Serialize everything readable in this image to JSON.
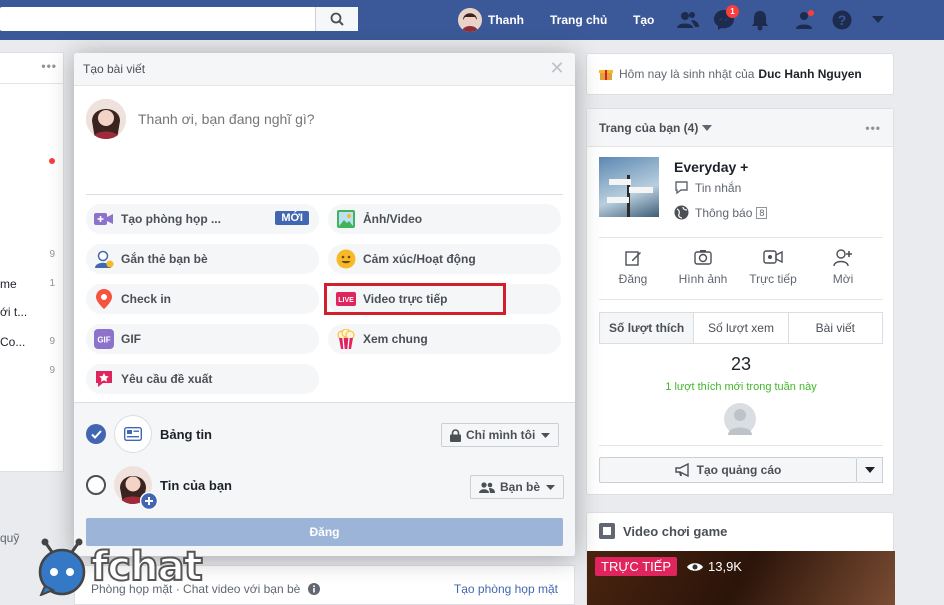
{
  "topbar": {
    "user_name": "Thanh",
    "home": "Trang chủ",
    "create": "Tạo",
    "messenger_badge": "1",
    "icons": [
      "search-icon",
      "friends-icon",
      "messenger-icon",
      "bell-icon",
      "groups-icon",
      "help-icon",
      "caret-down-icon"
    ]
  },
  "left": {
    "rows": [
      {
        "text": "",
        "num": "9"
      },
      {
        "text": "me",
        "num": "1"
      },
      {
        "text": "ới t...",
        "num": ""
      },
      {
        "text": "Co...",
        "num": "9"
      },
      {
        "text": "",
        "num": "9"
      }
    ],
    "bottom": "quỹ"
  },
  "modal": {
    "title": "Tạo bài viết",
    "placeholder": "Thanh ơi, bạn đang nghĩ gì?",
    "actions": [
      {
        "label": "Tạo phòng họp ...",
        "icon": "video-room-icon",
        "badge": "MỚI"
      },
      {
        "label": "Ảnh/Video",
        "icon": "photo-icon"
      },
      {
        "label": "Gắn thẻ bạn bè",
        "icon": "tag-friends-icon"
      },
      {
        "label": "Cảm xúc/Hoạt động",
        "icon": "smiley-icon"
      },
      {
        "label": "Check in",
        "icon": "location-pin-icon"
      },
      {
        "label": "Video trực tiếp",
        "icon": "live-video-icon",
        "icon_text": "LIVE"
      },
      {
        "label": "GIF",
        "icon": "gif-icon",
        "icon_text": "GIF"
      },
      {
        "label": "Xem chung",
        "icon": "popcorn-icon"
      },
      {
        "label": "Yêu cầu đề xuất",
        "icon": "recommendation-icon"
      }
    ],
    "feed_label": "Bảng tin",
    "feed_privacy": "Chỉ mình tôi",
    "story_label": "Tin của bạn",
    "story_privacy": "Bạn bè",
    "post_button": "Đăng"
  },
  "right": {
    "birthday_prefix": "Hôm nay là sinh nhật của",
    "birthday_name": "Duc Hanh Nguyen",
    "pages_title": "Trang của bạn (4)",
    "page_name": "Everyday +",
    "messages": "Tin nhắn",
    "notifications": "Thông báo",
    "notif_count": "8",
    "actions": [
      "Đăng",
      "Hình ảnh",
      "Trực tiếp",
      "Mời"
    ],
    "tabs": [
      "Số lượt thích",
      "Số lượt xem",
      "Bài viết"
    ],
    "stat_value": "23",
    "stat_sub": "1 lượt thích mới trong tuần này",
    "ad_button": "Tạo quảng cáo",
    "video_title": "Video chơi game",
    "live_tag": "TRỰC TIẾP",
    "views": "13,9K"
  },
  "bottom": {
    "left": "Phòng họp mặt · Chat video với bạn bè",
    "right": "Tạo phòng họp mặt"
  },
  "watermark": "fchat",
  "colors": {
    "brand": "#3b5998",
    "accent": "#4267b2",
    "live": "#e0245e",
    "highlight": "#d1202b"
  }
}
